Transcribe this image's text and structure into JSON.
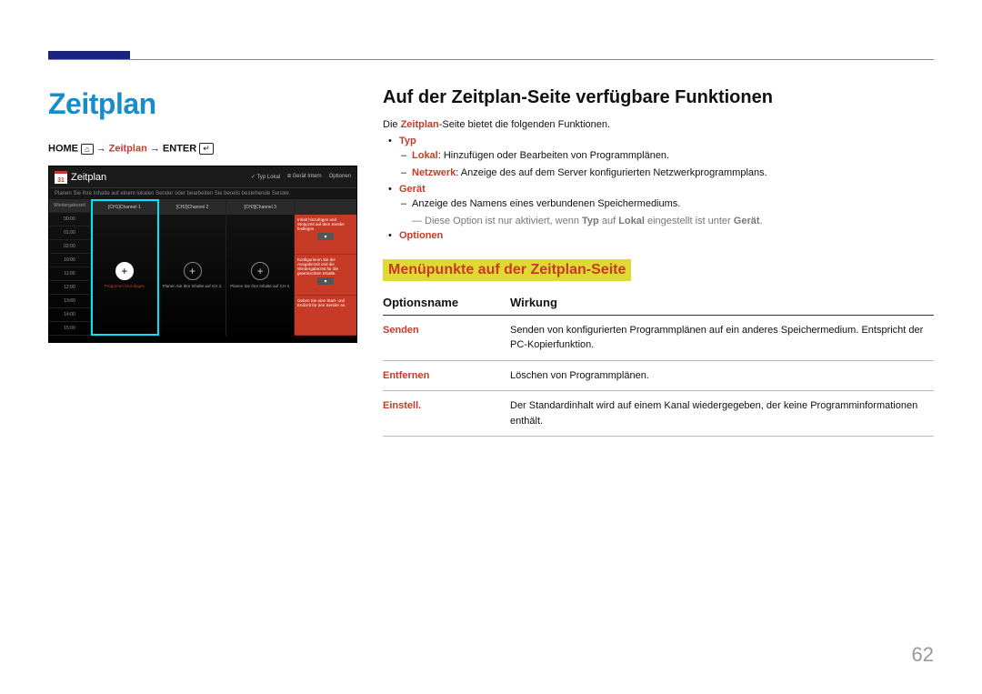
{
  "page_number": "62",
  "left": {
    "title": "Zeitplan",
    "breadcrumb": {
      "home": "HOME",
      "arrow": "→",
      "mid": "Zeitplan",
      "enter": "ENTER"
    },
    "mock": {
      "calendar_day": "31",
      "title": "Zeitplan",
      "top_items": [
        "Typ   Lokal",
        "Gerät   Intern",
        "Optionen"
      ],
      "subtitle": "Planen Sie Ihre Inhalte auf einem lokalen Sender oder bearbeiten Sie bereits bestehende Sender.",
      "time_header": "Wiedergabezeit",
      "times": [
        "00:00",
        "01:00",
        "02:00",
        "10:00",
        "11:00",
        "12:00",
        "13:00",
        "14:00",
        "15:00"
      ],
      "channels": [
        {
          "hdr": "[CH1]Channel 1",
          "label": "Programm hinzufügen"
        },
        {
          "hdr": "[CH2]Channel 2",
          "label": "Planen Sie Ihre Inhalte auf CH 2."
        },
        {
          "hdr": "[CH3]Channel 3",
          "label": "Planen Sie Ihre Inhalte auf CH 3."
        }
      ],
      "panel": [
        "Inhalt hinzufügen und Stoppzeit auf dem Sender festlegen.",
        "Konfigurieren Sie die Ausgabezeit und die Wiedergabezeit für die gewünschten Inhalte.",
        "Geben Sie eine Start- und Endzeit für den Sender an."
      ]
    }
  },
  "right": {
    "h2": "Auf der Zeitplan-Seite verfügbare Funktionen",
    "intro_pre": "Die ",
    "intro_bold": "Zeitplan",
    "intro_post": "-Seite bietet die folgenden Funktionen.",
    "items": {
      "typ": {
        "label": "Typ",
        "lokal_bold": "Lokal",
        "lokal_text": ": Hinzufügen oder Bearbeiten von Programmplänen.",
        "netz_bold": "Netzwerk",
        "netz_text": ": Anzeige des auf dem Server konfigurierten Netzwerkprogrammplans."
      },
      "geraet": {
        "label": "Gerät",
        "line": "Anzeige des Namens eines verbundenen Speichermediums.",
        "note_pre": "Diese Option ist nur aktiviert, wenn ",
        "note_b1": "Typ",
        "note_mid": " auf ",
        "note_b2": "Lokal",
        "note_mid2": " eingestellt ist unter ",
        "note_b3": "Gerät",
        "note_end": "."
      },
      "optionen": {
        "label": "Optionen"
      }
    },
    "h3": "Menüpunkte auf der Zeitplan-Seite",
    "table": {
      "col1": "Optionsname",
      "col2": "Wirkung",
      "rows": [
        {
          "name": "Senden",
          "desc": "Senden von konfigurierten Programmplänen auf ein anderes Speichermedium. Entspricht der PC-Kopierfunktion."
        },
        {
          "name": "Entfernen",
          "desc": "Löschen von Programmplänen."
        },
        {
          "name": "Einstell.",
          "desc": "Der Standardinhalt wird auf einem Kanal wiedergegeben, der keine Programminformationen enthält."
        }
      ]
    }
  }
}
